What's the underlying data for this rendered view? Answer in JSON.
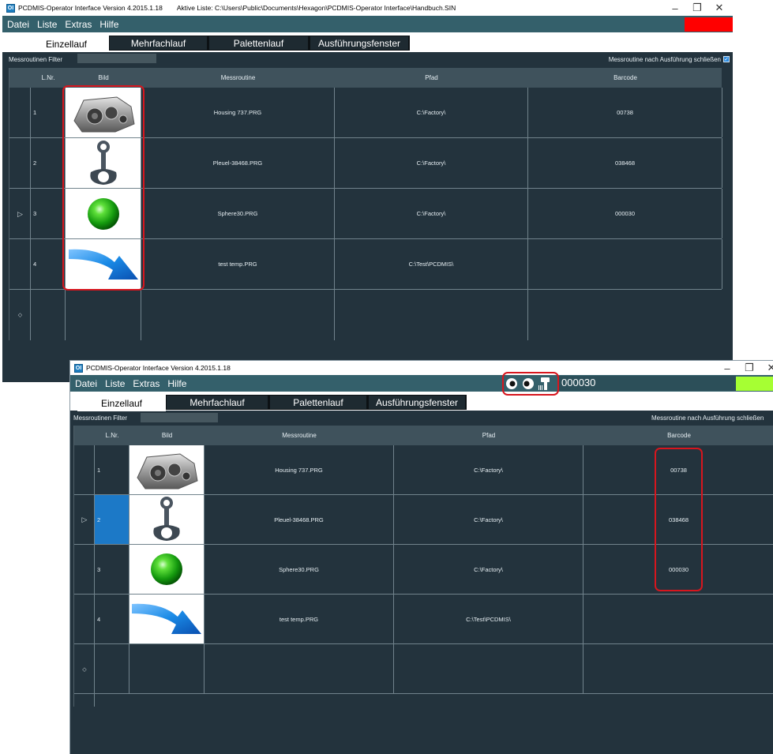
{
  "colors": {
    "accent_red": "#ff0000",
    "accent_green": "#a6ff33",
    "menubar": "#34606b",
    "panel": "#23333d",
    "select_blue": "#1c79c7"
  },
  "win1": {
    "title": "PCDMIS-Operator Interface  Version 4.2015.1.18",
    "active_list": "Aktive Liste: C:\\Users\\Public\\Documents\\Hexagon\\PCDMIS-Operator Interface\\Handbuch.SIN",
    "menu": [
      "Datei",
      "Liste",
      "Extras",
      "Hilfe"
    ],
    "tabs": [
      "Einzellauf",
      "Mehrfachlauf",
      "Palettenlauf",
      "Ausführungsfenster"
    ],
    "filter_label": "Messroutinen Filter",
    "close_after_label": "Messroutine nach Ausführung schließen",
    "columns": [
      "L.Nr.",
      "Bild",
      "Messroutine",
      "Pfad",
      "Barcode"
    ],
    "rows": [
      {
        "nr": "1",
        "image": "housing-image",
        "routine": "Housing 737.PRG",
        "path": "C:\\Factory\\",
        "barcode": "00738"
      },
      {
        "nr": "2",
        "image": "conrod-image",
        "routine": "Pleuel-38468.PRG",
        "path": "C:\\Factory\\",
        "barcode": "038468"
      },
      {
        "nr": "3",
        "image": "sphere-image",
        "routine": "Sphere30.PRG",
        "path": "C:\\Factory\\",
        "barcode": "000030"
      },
      {
        "nr": "4",
        "image": "arrow-image",
        "routine": "test temp.PRG",
        "path": "C:\\Test\\PCDMIS\\",
        "barcode": ""
      }
    ]
  },
  "win2": {
    "title": "PCDMIS-Operator Interface  Version 4.2015.1.18",
    "menu": [
      "Datei",
      "Liste",
      "Extras",
      "Hilfe"
    ],
    "search_value": "000030",
    "tabs": [
      "Einzellauf",
      "Mehrfachlauf",
      "Palettenlauf",
      "Ausführungsfenster"
    ],
    "filter_label": "Messroutinen Filter",
    "close_after_label": "Messroutine nach Ausführung schließen",
    "columns": [
      "L.Nr.",
      "Bild",
      "Messroutine",
      "Pfad",
      "Barcode"
    ],
    "rows": [
      {
        "nr": "1",
        "image": "housing-image",
        "routine": "Housing 737.PRG",
        "path": "C:\\Factory\\",
        "barcode": "00738"
      },
      {
        "nr": "2",
        "image": "conrod-image",
        "routine": "Pleuel-38468.PRG",
        "path": "C:\\Factory\\",
        "barcode": "038468"
      },
      {
        "nr": "3",
        "image": "sphere-image",
        "routine": "Sphere30.PRG",
        "path": "C:\\Factory\\",
        "barcode": "000030"
      },
      {
        "nr": "4",
        "image": "arrow-image",
        "routine": "test temp.PRG",
        "path": "C:\\Test\\PCDMIS\\",
        "barcode": ""
      }
    ]
  }
}
